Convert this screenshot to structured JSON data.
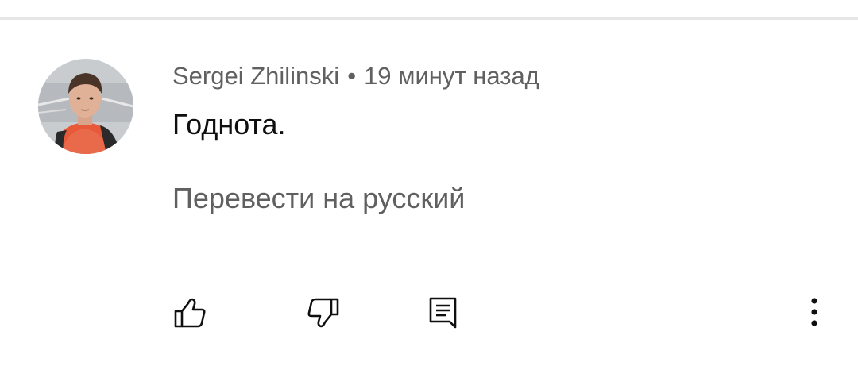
{
  "comment": {
    "author": "Sergei Zhilinski",
    "separator": "•",
    "time_ago": "19 минут назад",
    "text": "Годнота.",
    "translate_label": "Перевести на русский"
  },
  "actions": {
    "like_icon": "thumb-up-icon",
    "dislike_icon": "thumb-down-icon",
    "reply_icon": "comment-reply-icon",
    "more_icon": "more-vertical-icon"
  },
  "colors": {
    "secondary_text": "#606060",
    "primary_text": "#0f0f0f",
    "divider": "#e6e6e6"
  }
}
